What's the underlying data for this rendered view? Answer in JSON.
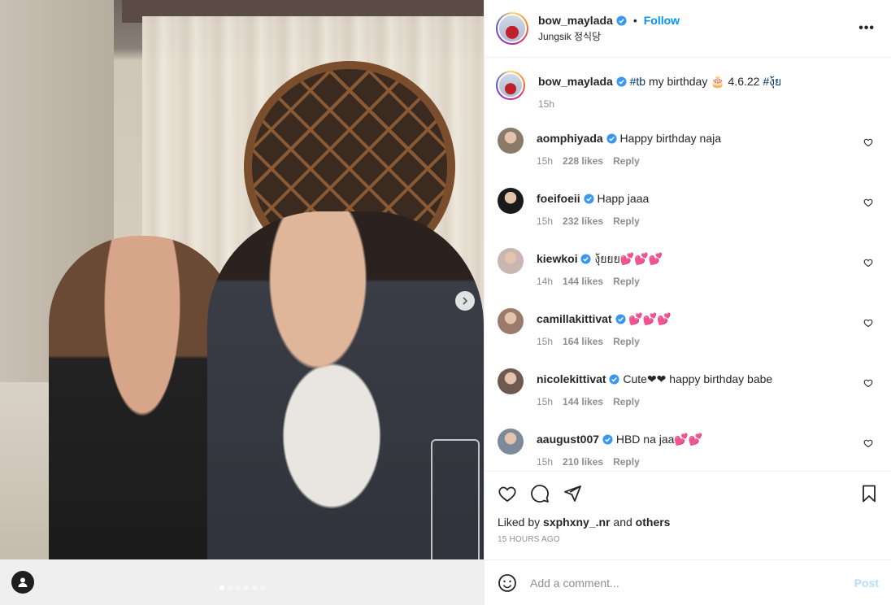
{
  "post": {
    "username": "bow_maylada",
    "follow_label": "Follow",
    "location": "Jungsik 정식당",
    "more_label": "•••"
  },
  "caption": {
    "username": "bow_maylada",
    "hashtag1": "#tb",
    "text": " my birthday 🎂 4.6.22 ",
    "hashtag2": "#งุ้ย",
    "time": "15h"
  },
  "comments": [
    {
      "username": "aomphiyada",
      "text": "Happy birthday naja",
      "time": "15h",
      "likes": "228 likes",
      "reply": "Reply",
      "avatar_color": "#8a7a6a"
    },
    {
      "username": "foeifoeii",
      "text": "Happ jaaa",
      "time": "15h",
      "likes": "232 likes",
      "reply": "Reply",
      "avatar_color": "#1a1a1a"
    },
    {
      "username": "kiewkoi",
      "text": "งุ้ยยย💕💕💕",
      "time": "14h",
      "likes": "144 likes",
      "reply": "Reply",
      "avatar_color": "#c9b6b0"
    },
    {
      "username": "camillakittivat",
      "text": "💕💕💕",
      "time": "15h",
      "likes": "164 likes",
      "reply": "Reply",
      "avatar_color": "#9a7b6c"
    },
    {
      "username": "nicolekittivat",
      "text": "Cute❤❤ happy birthday babe",
      "time": "15h",
      "likes": "144 likes",
      "reply": "Reply",
      "avatar_color": "#6f5a50"
    },
    {
      "username": "aaugust007",
      "text": "HBD na jaa💕💕",
      "time": "15h",
      "likes": "210 likes",
      "reply": "Reply",
      "avatar_color": "#7d8a99"
    }
  ],
  "engagement": {
    "liked_by_prefix": "Liked by ",
    "liked_by_user": "sxphxny_.nr",
    "liked_by_mid": " and ",
    "liked_by_others": "others",
    "timestamp": "15 HOURS AGO"
  },
  "composer": {
    "placeholder": "Add a comment...",
    "post_label": "Post"
  },
  "media": {
    "carousel_count": 6,
    "carousel_active": 1
  },
  "colors": {
    "accent": "#0095f6",
    "verified": "#3897f0",
    "hashtag": "#00376b",
    "muted": "#8e8e8e"
  }
}
